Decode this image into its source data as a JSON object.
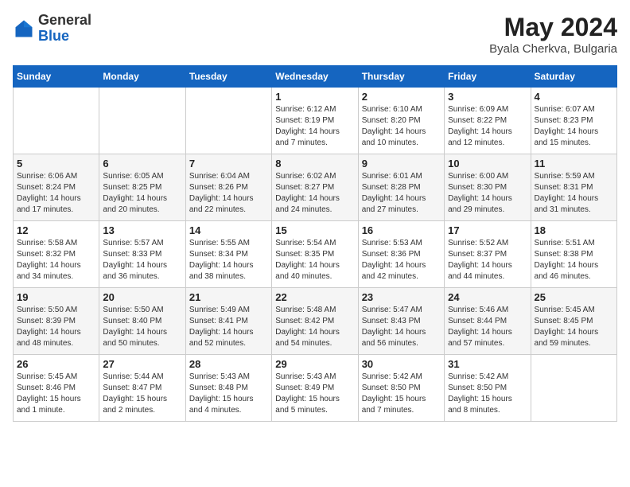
{
  "header": {
    "logo_general": "General",
    "logo_blue": "Blue",
    "month_title": "May 2024",
    "location": "Byala Cherkva, Bulgaria"
  },
  "days_of_week": [
    "Sunday",
    "Monday",
    "Tuesday",
    "Wednesday",
    "Thursday",
    "Friday",
    "Saturday"
  ],
  "weeks": [
    [
      {
        "day": "",
        "info": ""
      },
      {
        "day": "",
        "info": ""
      },
      {
        "day": "",
        "info": ""
      },
      {
        "day": "1",
        "info": "Sunrise: 6:12 AM\nSunset: 8:19 PM\nDaylight: 14 hours\nand 7 minutes."
      },
      {
        "day": "2",
        "info": "Sunrise: 6:10 AM\nSunset: 8:20 PM\nDaylight: 14 hours\nand 10 minutes."
      },
      {
        "day": "3",
        "info": "Sunrise: 6:09 AM\nSunset: 8:22 PM\nDaylight: 14 hours\nand 12 minutes."
      },
      {
        "day": "4",
        "info": "Sunrise: 6:07 AM\nSunset: 8:23 PM\nDaylight: 14 hours\nand 15 minutes."
      }
    ],
    [
      {
        "day": "5",
        "info": "Sunrise: 6:06 AM\nSunset: 8:24 PM\nDaylight: 14 hours\nand 17 minutes."
      },
      {
        "day": "6",
        "info": "Sunrise: 6:05 AM\nSunset: 8:25 PM\nDaylight: 14 hours\nand 20 minutes."
      },
      {
        "day": "7",
        "info": "Sunrise: 6:04 AM\nSunset: 8:26 PM\nDaylight: 14 hours\nand 22 minutes."
      },
      {
        "day": "8",
        "info": "Sunrise: 6:02 AM\nSunset: 8:27 PM\nDaylight: 14 hours\nand 24 minutes."
      },
      {
        "day": "9",
        "info": "Sunrise: 6:01 AM\nSunset: 8:28 PM\nDaylight: 14 hours\nand 27 minutes."
      },
      {
        "day": "10",
        "info": "Sunrise: 6:00 AM\nSunset: 8:30 PM\nDaylight: 14 hours\nand 29 minutes."
      },
      {
        "day": "11",
        "info": "Sunrise: 5:59 AM\nSunset: 8:31 PM\nDaylight: 14 hours\nand 31 minutes."
      }
    ],
    [
      {
        "day": "12",
        "info": "Sunrise: 5:58 AM\nSunset: 8:32 PM\nDaylight: 14 hours\nand 34 minutes."
      },
      {
        "day": "13",
        "info": "Sunrise: 5:57 AM\nSunset: 8:33 PM\nDaylight: 14 hours\nand 36 minutes."
      },
      {
        "day": "14",
        "info": "Sunrise: 5:55 AM\nSunset: 8:34 PM\nDaylight: 14 hours\nand 38 minutes."
      },
      {
        "day": "15",
        "info": "Sunrise: 5:54 AM\nSunset: 8:35 PM\nDaylight: 14 hours\nand 40 minutes."
      },
      {
        "day": "16",
        "info": "Sunrise: 5:53 AM\nSunset: 8:36 PM\nDaylight: 14 hours\nand 42 minutes."
      },
      {
        "day": "17",
        "info": "Sunrise: 5:52 AM\nSunset: 8:37 PM\nDaylight: 14 hours\nand 44 minutes."
      },
      {
        "day": "18",
        "info": "Sunrise: 5:51 AM\nSunset: 8:38 PM\nDaylight: 14 hours\nand 46 minutes."
      }
    ],
    [
      {
        "day": "19",
        "info": "Sunrise: 5:50 AM\nSunset: 8:39 PM\nDaylight: 14 hours\nand 48 minutes."
      },
      {
        "day": "20",
        "info": "Sunrise: 5:50 AM\nSunset: 8:40 PM\nDaylight: 14 hours\nand 50 minutes."
      },
      {
        "day": "21",
        "info": "Sunrise: 5:49 AM\nSunset: 8:41 PM\nDaylight: 14 hours\nand 52 minutes."
      },
      {
        "day": "22",
        "info": "Sunrise: 5:48 AM\nSunset: 8:42 PM\nDaylight: 14 hours\nand 54 minutes."
      },
      {
        "day": "23",
        "info": "Sunrise: 5:47 AM\nSunset: 8:43 PM\nDaylight: 14 hours\nand 56 minutes."
      },
      {
        "day": "24",
        "info": "Sunrise: 5:46 AM\nSunset: 8:44 PM\nDaylight: 14 hours\nand 57 minutes."
      },
      {
        "day": "25",
        "info": "Sunrise: 5:45 AM\nSunset: 8:45 PM\nDaylight: 14 hours\nand 59 minutes."
      }
    ],
    [
      {
        "day": "26",
        "info": "Sunrise: 5:45 AM\nSunset: 8:46 PM\nDaylight: 15 hours\nand 1 minute."
      },
      {
        "day": "27",
        "info": "Sunrise: 5:44 AM\nSunset: 8:47 PM\nDaylight: 15 hours\nand 2 minutes."
      },
      {
        "day": "28",
        "info": "Sunrise: 5:43 AM\nSunset: 8:48 PM\nDaylight: 15 hours\nand 4 minutes."
      },
      {
        "day": "29",
        "info": "Sunrise: 5:43 AM\nSunset: 8:49 PM\nDaylight: 15 hours\nand 5 minutes."
      },
      {
        "day": "30",
        "info": "Sunrise: 5:42 AM\nSunset: 8:50 PM\nDaylight: 15 hours\nand 7 minutes."
      },
      {
        "day": "31",
        "info": "Sunrise: 5:42 AM\nSunset: 8:50 PM\nDaylight: 15 hours\nand 8 minutes."
      },
      {
        "day": "",
        "info": ""
      }
    ]
  ]
}
